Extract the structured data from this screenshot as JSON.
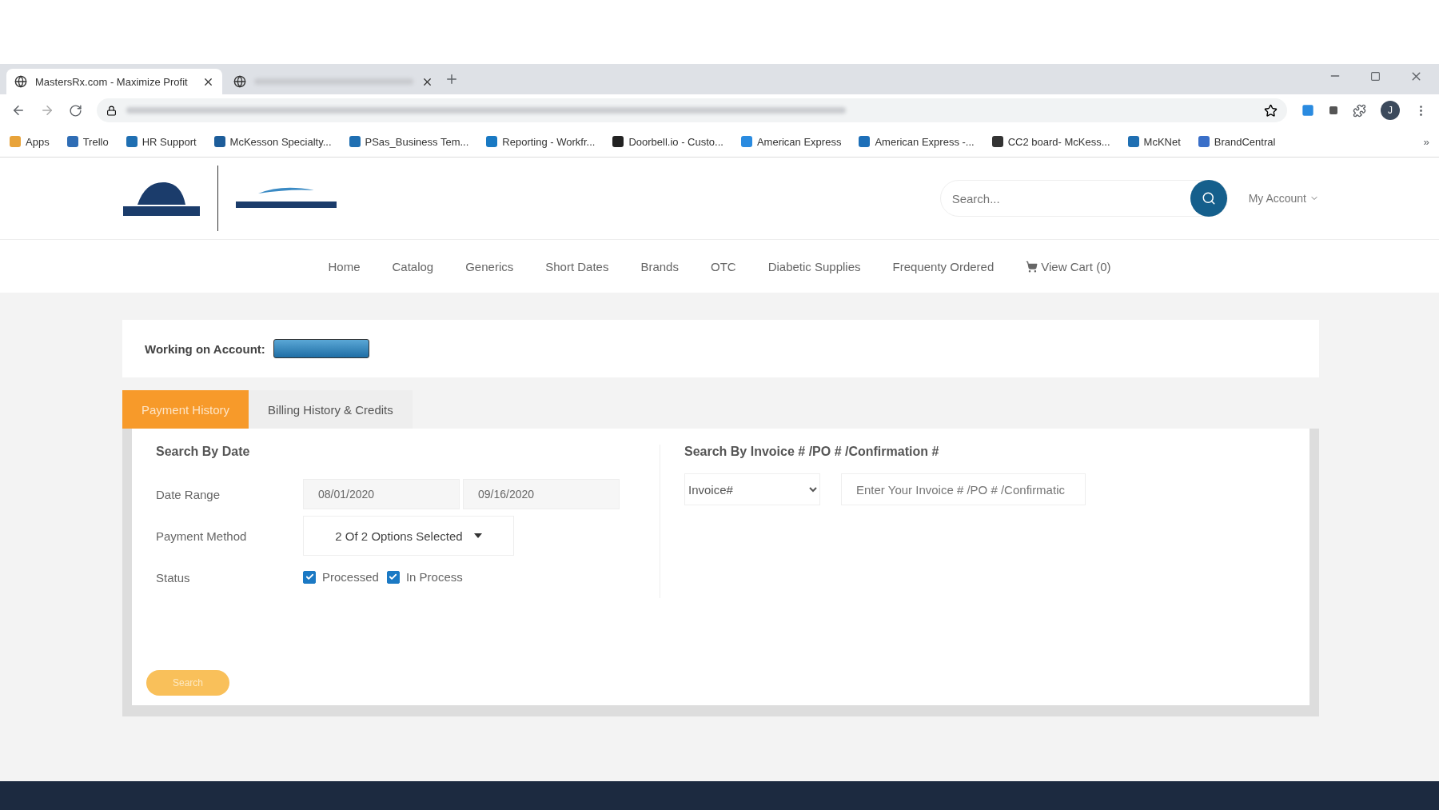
{
  "browser": {
    "tabs": [
      {
        "title": "MastersRx.com - Maximize Profit",
        "selected": true
      },
      {
        "selected": false
      }
    ],
    "bookmarks": [
      {
        "label": "Apps",
        "color": "#e8a33a"
      },
      {
        "label": "Trello",
        "color": "#2f6db5"
      },
      {
        "label": "HR Support",
        "color": "#1f6fb2"
      },
      {
        "label": "McKesson Specialty...",
        "color": "#1d5d9a"
      },
      {
        "label": "PSas_Business Tem...",
        "color": "#1f6fb2"
      },
      {
        "label": "Reporting - Workfr...",
        "color": "#1979c3"
      },
      {
        "label": "Doorbell.io - Custo...",
        "color": "#222222"
      },
      {
        "label": "American Express",
        "color": "#2a8be0"
      },
      {
        "label": "American Express -...",
        "color": "#1d6fb8"
      },
      {
        "label": "CC2 board- McKess...",
        "color": "#333333"
      },
      {
        "label": "McKNet",
        "color": "#1f6fb2"
      },
      {
        "label": "BrandCentral",
        "color": "#3a6fc8"
      }
    ],
    "overflow": "»",
    "profile_initial": "J"
  },
  "header": {
    "search": {
      "placeholder": "Search..."
    },
    "account_menu": "My Account"
  },
  "nav": [
    {
      "label": "Home"
    },
    {
      "label": "Catalog"
    },
    {
      "label": "Generics"
    },
    {
      "label": "Short Dates"
    },
    {
      "label": "Brands"
    },
    {
      "label": "OTC"
    },
    {
      "label": "Diabetic Supplies"
    },
    {
      "label": "Frequenty Ordered"
    },
    {
      "label": "View Cart (0)",
      "kind": "cart"
    }
  ],
  "account": {
    "label": "Working on Account:"
  },
  "tabs": [
    {
      "label": "Payment History",
      "selected": true
    },
    {
      "label": "Billing History & Credits",
      "selected": false
    }
  ],
  "date_section": {
    "title": "Search By Date",
    "date_range": {
      "label": "Date Range",
      "from": "08/01/2020",
      "to": "09/16/2020"
    },
    "payment_method": {
      "label": "Payment Method",
      "value": "2 Of 2 Options Selected"
    },
    "status": {
      "label": "Status",
      "options": [
        {
          "label": "Processed",
          "checked": true
        },
        {
          "label": "In Process",
          "checked": true
        }
      ]
    }
  },
  "invoice_section": {
    "title": "Search By Invoice # /PO # /Confirmation #",
    "type": "Invoice#",
    "placeholder": "Enter Your Invoice # /PO # /Confirmatic"
  },
  "search_button": "Search"
}
